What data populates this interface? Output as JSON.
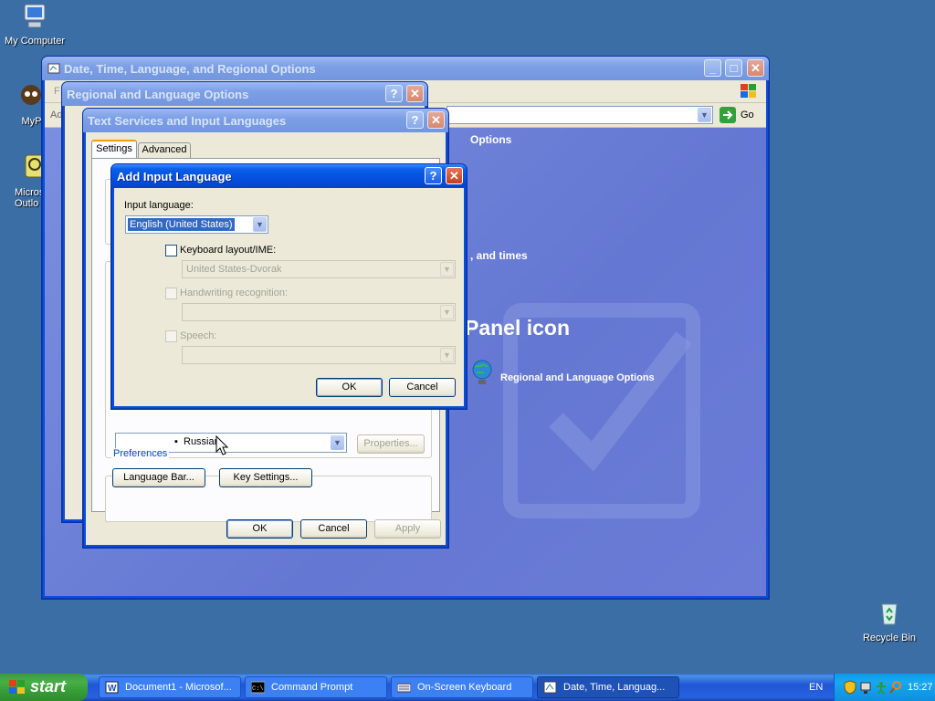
{
  "desktop": {
    "icons": [
      {
        "label": "My Computer"
      },
      {
        "label": "MyPal"
      },
      {
        "label": "Micros Outlo"
      },
      {
        "label": "Recycle Bin"
      }
    ]
  },
  "main_window": {
    "title": "Date, Time, Language, and Regional Options",
    "address_label": "Ad",
    "go_label": "Go",
    "header_fragment": "Options",
    "task_fragment": ", and times",
    "panel_heading": "Panel icon",
    "panel_link": "Regional and Language Options",
    "back_char": "F"
  },
  "regional_dialog": {
    "title": "Regional and Language Options"
  },
  "text_services": {
    "title": "Text Services and Input Languages",
    "tabs": [
      "Settings",
      "Advanced"
    ],
    "installed_item": "Russian",
    "properties_label": "Properties...",
    "preferences_label": "Preferences",
    "language_bar_label": "Language Bar...",
    "key_settings_label": "Key Settings...",
    "ok_label": "OK",
    "cancel_label": "Cancel",
    "apply_label": "Apply"
  },
  "add_input": {
    "title": "Add Input Language",
    "input_language_label": "Input language:",
    "input_language_value": "English (United States)",
    "keyboard_label": "Keyboard layout/IME:",
    "keyboard_value": "United States-Dvorak",
    "handwriting_label": "Handwriting recognition:",
    "speech_label": "Speech:",
    "ok_label": "OK",
    "cancel_label": "Cancel"
  },
  "taskbar": {
    "start_label": "start",
    "tasks": [
      {
        "label": "Document1 - Microsof..."
      },
      {
        "label": "Command Prompt"
      },
      {
        "label": "On-Screen Keyboard"
      },
      {
        "label": "Date, Time, Languag..."
      }
    ],
    "lang": "EN",
    "clock": "15:27"
  },
  "colors": {
    "desktop": "#3a6ea5",
    "titlebar_active": "#0550e0",
    "panel_bg": "#6f83d9",
    "start_green": "#3c9a3c"
  }
}
